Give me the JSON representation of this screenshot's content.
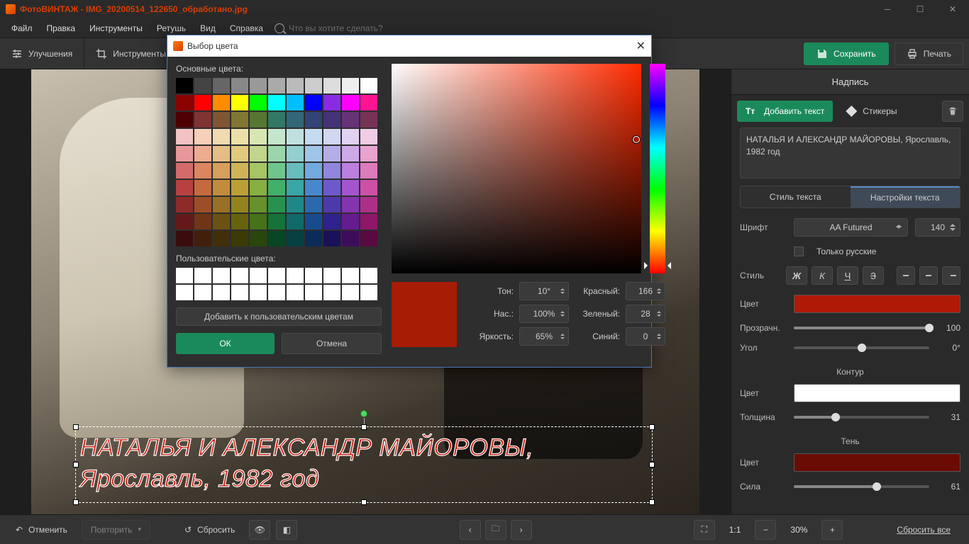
{
  "title": "ФотоВИНТАЖ - IMG_20200514_122650_обработано.jpg",
  "menu": [
    "Файл",
    "Правка",
    "Инструменты",
    "Ретушь",
    "Вид",
    "Справка"
  ],
  "search_placeholder": "Что вы хотите сделать?",
  "toolbar": {
    "enhance": "Улучшения",
    "tools": "Инструменты",
    "save": "Сохранить",
    "print": "Печать"
  },
  "caption_text": "НАТАЛЬЯ И АЛЕКСАНДР МАЙОРОВЫ,\nЯрославль, 1982 год",
  "panel": {
    "head": "Надпись",
    "add_text": "Добавить текст",
    "stickers": "Стикеры",
    "text_value": "НАТАЛЬЯ И АЛЕКСАНДР МАЙОРОВЫ, Ярославль, 1982 год",
    "tabs": {
      "style": "Стиль текста",
      "settings": "Настройки текста"
    },
    "font_label": "Шрифт",
    "font_value": "AA Futured",
    "font_size": "140",
    "russian_only": "Только русские",
    "style_label": "Стиль",
    "color_label": "Цвет",
    "fill_color": "#b11a08",
    "opacity_label": "Прозрачн.",
    "opacity_value": "100",
    "angle_label": "Угол",
    "angle_value": "0°",
    "outline": "Контур",
    "outline_color": "#ffffff",
    "thickness_label": "Толщина",
    "thickness_value": "31",
    "shadow": "Тень",
    "shadow_color": "#6a0c04",
    "strength_label": "Сила",
    "strength_value": "61"
  },
  "bottom": {
    "undo": "Отменить",
    "redo": "Повторить",
    "reset": "Сбросить",
    "zoom": "1:1",
    "zoom_pct": "30%",
    "reset_all": "Сбросить все"
  },
  "dialog": {
    "title": "Выбор цвета",
    "basic": "Основные цвета:",
    "custom": "Пользовательские цвета:",
    "add": "Добавить к пользовательским цветам",
    "ok": "ОК",
    "cancel": "Отмена",
    "hue": "Тон:",
    "hue_v": "10°",
    "sat": "Нас.:",
    "sat_v": "100%",
    "val": "Яркость:",
    "val_v": "65%",
    "red": "Красный:",
    "red_v": "166",
    "green": "Зеленый:",
    "green_v": "28",
    "blue": "Синий:",
    "blue_v": "0",
    "preview_color": "#a61c05",
    "swatches": [
      "#000000",
      "#444444",
      "#666666",
      "#888888",
      "#999999",
      "#aaaaaa",
      "#bbbbbb",
      "#cccccc",
      "#dddddd",
      "#eeeeee",
      "#ffffff",
      "#8b0000",
      "#ff0000",
      "#ff8c00",
      "#ffff00",
      "#00ff00",
      "#00ffff",
      "#00bfff",
      "#0000ff",
      "#8a2be2",
      "#ff00ff",
      "#ff1493",
      "#4d0000",
      "#803333",
      "#805533",
      "#807733",
      "#557733",
      "#337766",
      "#336677",
      "#334477",
      "#443377",
      "#663377",
      "#773355",
      "#f4c2c2",
      "#f6d0b8",
      "#f0dab0",
      "#ece0a8",
      "#d8e6b3",
      "#c4e6cc",
      "#c0e0e0",
      "#c4daf0",
      "#d2d6f0",
      "#e0d2f0",
      "#f0cde4",
      "#e89898",
      "#edab90",
      "#e5bd86",
      "#dfca7e",
      "#c1d58c",
      "#9bd5ac",
      "#94cfcf",
      "#9fc5e8",
      "#b4ade8",
      "#cfa8e8",
      "#e8a3cf",
      "#d36b6b",
      "#db8561",
      "#d69f5c",
      "#cfb457",
      "#a6c564",
      "#6fc58b",
      "#68bcbc",
      "#73a9de",
      "#9185de",
      "#bb7fde",
      "#de7bbc",
      "#b84040",
      "#c56a3e",
      "#c28c3a",
      "#ba9f34",
      "#86b042",
      "#41b06a",
      "#3aa6a6",
      "#4788cd",
      "#6c5acd",
      "#a455cd",
      "#cd50a6",
      "#8f2a2a",
      "#9c4e28",
      "#997025",
      "#92831f",
      "#66912c",
      "#28914f",
      "#218888",
      "#2c68ad",
      "#4c3aad",
      "#8435ad",
      "#ad3088",
      "#631919",
      "#703517",
      "#6d5114",
      "#66630e",
      "#46721a",
      "#167238",
      "#106969",
      "#184a8e",
      "#2f218e",
      "#651c8e",
      "#8e1769",
      "#3a0c0c",
      "#421f0b",
      "#402f09",
      "#3b3a05",
      "#29460e",
      "#094623",
      "#064040",
      "#0b2c59",
      "#1a1159",
      "#3e0d59",
      "#590a41"
    ]
  }
}
